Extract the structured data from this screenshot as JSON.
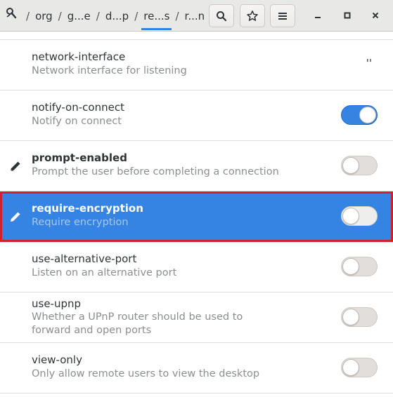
{
  "header": {
    "breadcrumb": [
      {
        "label": "/",
        "kind": "sep"
      },
      {
        "label": "org",
        "kind": "seg"
      },
      {
        "label": "/",
        "kind": "sep"
      },
      {
        "label": "g...e",
        "kind": "seg"
      },
      {
        "label": "/",
        "kind": "sep"
      },
      {
        "label": "d...p",
        "kind": "seg"
      },
      {
        "label": "/",
        "kind": "sep"
      },
      {
        "label": "re...s",
        "kind": "seg",
        "active": true
      },
      {
        "label": "/",
        "kind": "sep"
      },
      {
        "label": "r...n",
        "kind": "seg"
      }
    ],
    "search_icon": "search-icon",
    "bookmark_icon": "star-icon",
    "menu_icon": "hamburger-icon",
    "window_controls": [
      "minimize",
      "maximize",
      "close"
    ]
  },
  "rows": [
    {
      "key": "network-interface",
      "description": "Network interface for listening",
      "value": "''",
      "type": "string"
    },
    {
      "key": "notify-on-connect",
      "description": "Notify on connect",
      "state": "on",
      "type": "bool"
    },
    {
      "key": "prompt-enabled",
      "description": "Prompt the user before completing a connection",
      "state": "off",
      "type": "bool",
      "modified": true
    },
    {
      "key": "require-encryption",
      "description": "Require encryption",
      "state": "off",
      "type": "bool",
      "modified": true,
      "selected": true
    },
    {
      "key": "use-alternative-port",
      "description": "Listen on an alternative port",
      "state": "off",
      "type": "bool"
    },
    {
      "key": "use-upnp",
      "description_lines": [
        "Whether a UPnP router should be used to",
        "forward and open ports"
      ],
      "state": "off",
      "type": "bool"
    },
    {
      "key": "view-only",
      "description": "Only allow remote users to view the desktop",
      "state": "off",
      "type": "bool"
    }
  ],
  "colors": {
    "accent": "#3584e4",
    "selection_outline": "#d0222e",
    "header_bg": "#e8e8e7"
  }
}
